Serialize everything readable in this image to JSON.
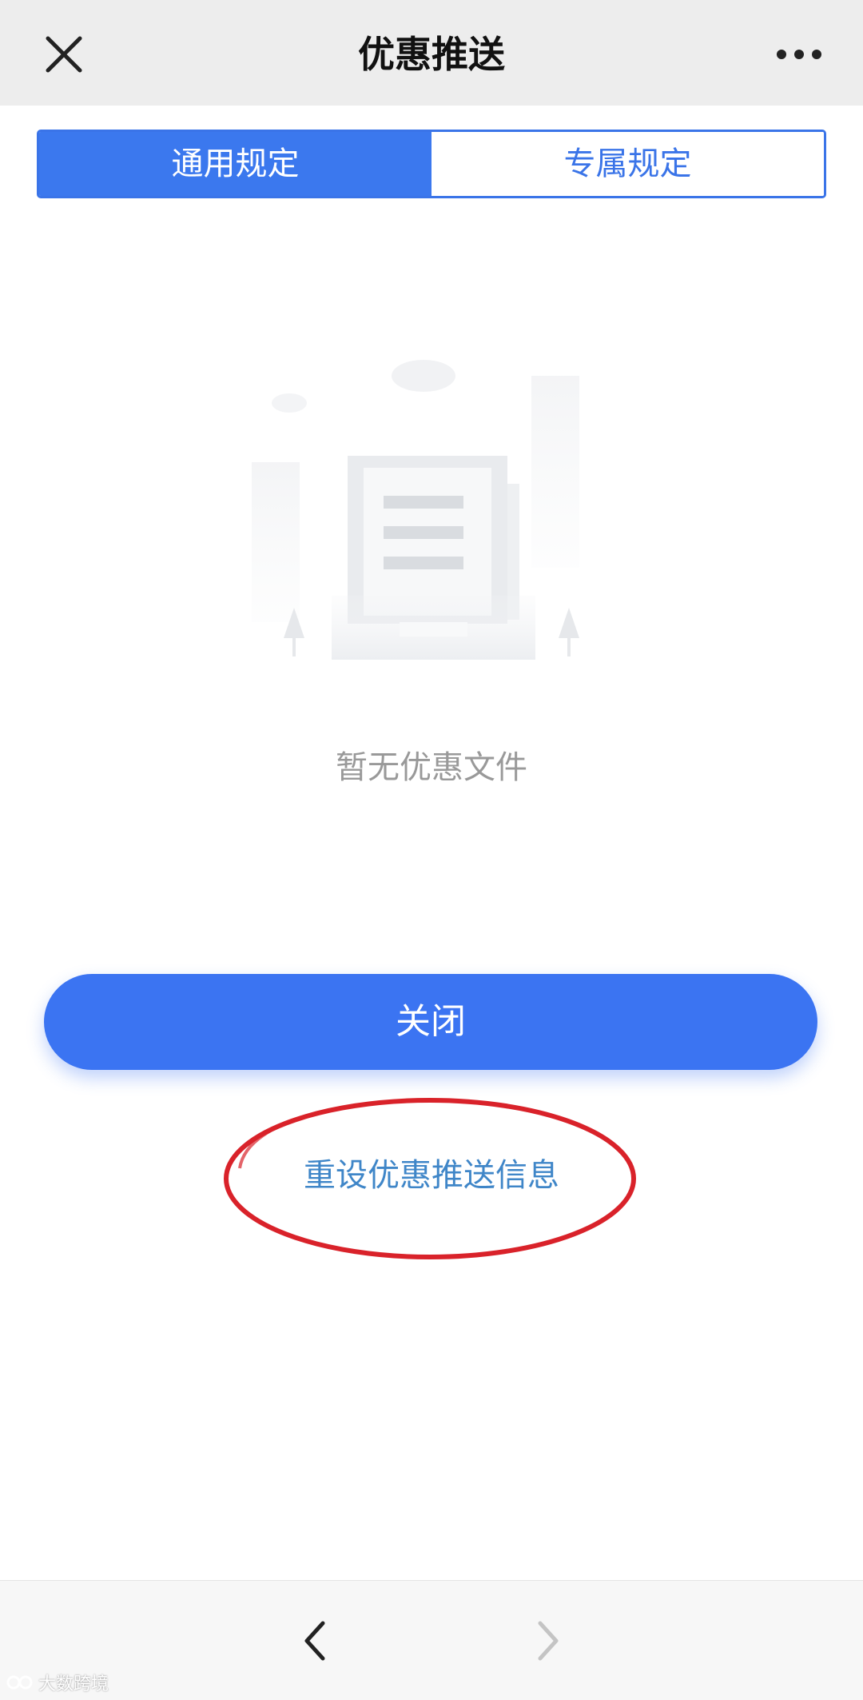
{
  "header": {
    "title": "优惠推送",
    "close_icon": "close-icon",
    "more_icon": "more-horizontal-icon"
  },
  "tabs": [
    {
      "label": "通用规定",
      "active": true
    },
    {
      "label": "专属规定",
      "active": false
    }
  ],
  "empty_state": {
    "icon": "empty-document-illustration",
    "message": "暂无优惠文件"
  },
  "actions": {
    "close_button_label": "关闭",
    "reset_link_label": "重设优惠推送信息"
  },
  "annotation": {
    "shape": "ellipse",
    "color": "#d9222a"
  },
  "bottom_nav": {
    "back_icon": "chevron-left-icon",
    "forward_icon": "chevron-right-icon",
    "forward_enabled": false
  },
  "watermark": {
    "text": "大数跨境"
  },
  "colors": {
    "primary": "#3b74f2",
    "tab_active": "#3b78ee",
    "link": "#3f86c8",
    "title_bar": "#ededed"
  }
}
